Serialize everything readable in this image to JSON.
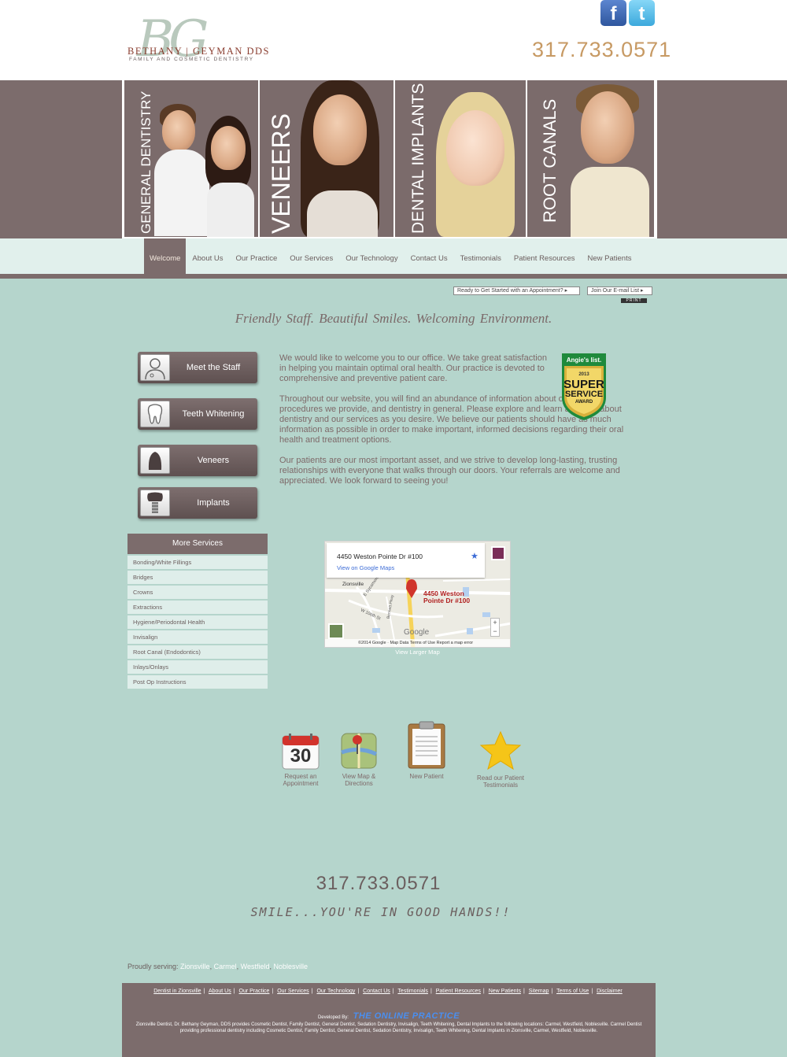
{
  "header": {
    "logo_monogram": "BG",
    "logo_name": "BETHANY | GEYMAN DDS",
    "logo_tagline": "FAMILY AND COSMETIC DENTISTRY",
    "facebook_icon": "f",
    "twitter_icon": "t",
    "phone": "317.733.0571"
  },
  "banner": {
    "panels": [
      "GENERAL DENTISTRY",
      "VENEERS",
      "DENTAL IMPLANTS",
      "ROOT CANALS"
    ]
  },
  "nav": {
    "items": [
      "Welcome",
      "About Us",
      "Our Practice",
      "Our Services",
      "Our Technology",
      "Contact Us",
      "Testimonials",
      "Patient Resources",
      "New Patients"
    ]
  },
  "utility": {
    "appointment": "Ready to Get Started with an Appointment?  ▸",
    "email_list": "Join Our E-mail List  ▸",
    "print": "PRINT"
  },
  "tagline": "Friendly Staff.   Beautiful Smiles.  Welcoming Environment.",
  "services": [
    {
      "label": "Meet the Staff"
    },
    {
      "label": "Teeth Whitening"
    },
    {
      "label": "Veneers"
    },
    {
      "label": "Implants"
    }
  ],
  "more_services": {
    "title": "More Services",
    "items": [
      "Bonding/White Fillings",
      "Bridges",
      "Crowns",
      "Extractions",
      "Hygiene/Periodontal Health",
      "Invisalign",
      "Root Canal (Endodontics)",
      "Inlays/Onlays",
      "Post Op Instructions"
    ]
  },
  "welcome": {
    "p1": "We would like to welcome you to our office. We take great satisfaction in helping you maintain optimal oral health. Our practice is devoted to comprehensive and preventive patient care.",
    "p2": "Throughout our website, you will find an abundance of information about our practice, procedures we provide, and dentistry in general. Please explore and learn as much about dentistry and our services as you desire. We believe our patients should have as much information as possible in order to make important, informed decisions regarding their oral health and treatment options.",
    "p3": "Our patients are our most important asset, and we strive to develop long-lasting, trusting relationships with everyone that walks through our doors. Your referrals are welcome and appreciated. We look forward to seeing you!"
  },
  "badge": {
    "brand": "Angie's list.",
    "year": "2013",
    "line1": "SUPER",
    "line2": "SERVICE",
    "line3": "AWARD"
  },
  "map": {
    "address": "4450 Weston Pointe Dr #100",
    "google_link": "View on Google Maps",
    "pin_label_1": "4450 Weston",
    "pin_label_2": "Pointe Dr #100",
    "town": "Zionsville",
    "street1": "E Sycamore",
    "street2": "W 106th St",
    "street3": "Bennett Pkwy",
    "google": "Google",
    "footer": "©2014 Google · Map Data   Terms of Use    Report a map error",
    "larger": "View Larger Map"
  },
  "bottom_icons": [
    {
      "label": "Request an Appointment",
      "number": "30"
    },
    {
      "label": "View Map & Directions"
    },
    {
      "label": "New Patient"
    },
    {
      "label": "Read our Patient Testimonials"
    }
  ],
  "footer_phone": "317.733.0571",
  "slogan": "SMILE...YOU'RE IN GOOD HANDS!!",
  "serving": {
    "prefix": "Proudly serving:",
    "cities": [
      "Zionsville",
      "Carmel",
      "Westfield",
      "Noblesville"
    ]
  },
  "footer": {
    "links": [
      "Dentist in Zionsville",
      "About Us",
      "Our Practice",
      "Our Services",
      "Our Technology",
      "Contact Us",
      "Testimonials",
      "Patient Resources",
      "New Patients",
      "Sitemap",
      "Terms of Use",
      "Disclaimer"
    ],
    "developed_by": "Developed By:",
    "developer": "THE ONLINE PRACTICE",
    "description": "Zionsville Dentist, Dr. Bethany Geyman, DDS provides Cosmetic Dentist, Family Dentist, General Dentist, Sedation Dentistry, Invisalign, Teeth Whitening, Dental Implants to the following locations: Carmel, Westfield, Noblesville. Carmel Dentist providing professional dentistry including Cosmetic Dentist, Family Dentist, General Dentist, Sedation Dentistry, Invisalign, Teeth Whitening, Dental Implants in Zionsville, Carmel, Westfield, Noblesville."
  },
  "colors": {
    "background": "#b5d5cc",
    "brand_brown": "#7c6c6c",
    "nav_light": "#e1f0ec",
    "phone_gold": "#c79a64"
  }
}
